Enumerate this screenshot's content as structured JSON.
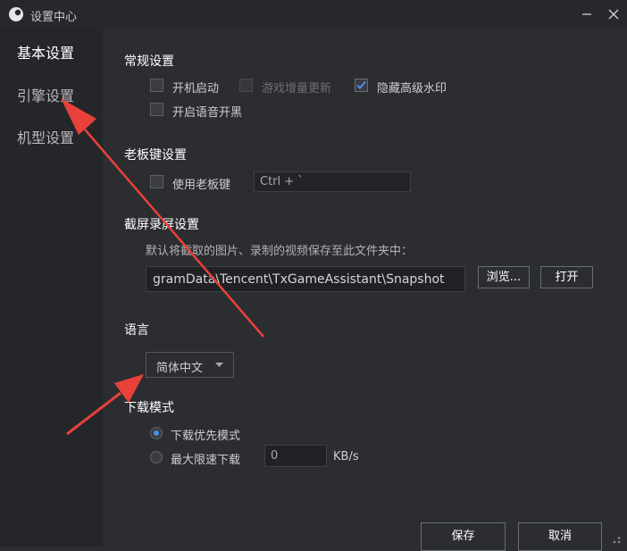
{
  "window": {
    "title": "设置中心",
    "minimize_icon": "minimize-icon",
    "close_icon": "close-icon"
  },
  "sidebar": {
    "items": [
      {
        "label": "基本设置",
        "active": true
      },
      {
        "label": "引擎设置",
        "active": false
      },
      {
        "label": "机型设置",
        "active": false
      }
    ]
  },
  "general": {
    "title": "常规设置",
    "startup_label": "开机启动",
    "startup_checked": false,
    "incremental_update_label": "游戏增量更新",
    "incremental_update_checked": false,
    "incremental_update_disabled": true,
    "hide_watermark_label": "隐藏高级水印",
    "hide_watermark_checked": true,
    "voice_label": "开启语音开黑",
    "voice_checked": false
  },
  "boss_key": {
    "title": "老板键设置",
    "enable_label": "使用老板键",
    "enable_checked": false,
    "shortcut_value": "Ctrl + `"
  },
  "screenshot": {
    "title": "截屏录屏设置",
    "description": "默认将截取的图片、录制的视频保存至此文件夹中：",
    "path_value": "gramData\\Tencent\\TxGameAssistant\\Snapshot",
    "browse_label": "浏览...",
    "open_label": "打开"
  },
  "language": {
    "title": "语言",
    "selected": "简体中文"
  },
  "download": {
    "title": "下载模式",
    "priority_label": "下载优先模式",
    "priority_selected": true,
    "limit_label": "最大限速下载",
    "limit_selected": false,
    "limit_value": "0",
    "limit_unit": "KB/s"
  },
  "footer": {
    "save_label": "保存",
    "cancel_label": "取消"
  },
  "colors": {
    "accent": "#4b8fe8",
    "annotation_arrow": "#e8413a"
  }
}
